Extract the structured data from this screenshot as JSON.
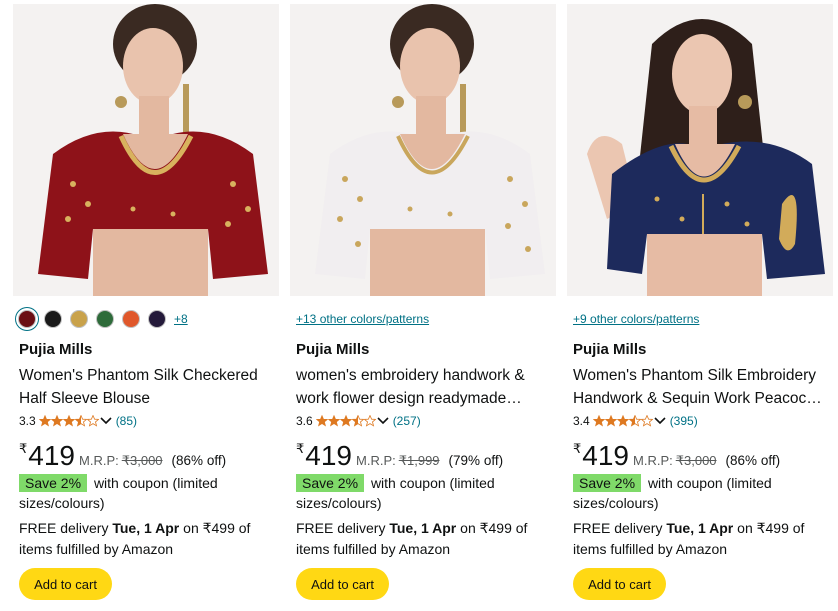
{
  "colors": {
    "link": "#007185",
    "button": "#ffd814",
    "badge": "#7fda69",
    "star": "#de7921"
  },
  "products": [
    {
      "brand": "Pujia Mills",
      "title": "Women's Phantom Silk Checkered Half Sleeve Blouse",
      "rating": "3.3",
      "rating_count": "(85)",
      "currency": "₹",
      "price": "419",
      "mrp_label": "M.R.P:",
      "mrp": "₹3,000",
      "discount": "(86% off)",
      "save_badge": "Save 2%",
      "coupon_text": "with coupon (limited sizes/colours)",
      "delivery_prefix": "FREE delivery",
      "delivery_date": "Tue, 1 Apr",
      "delivery_suffix": "on ₹499 of items fulfilled by Amazon",
      "cart_label": "Add to cart",
      "more_colors": "+8",
      "swatch_colors": [
        "#6b0f14",
        "#1a1a1a",
        "#c9a24b",
        "#2e6b3a",
        "#e0582b",
        "#241a3a"
      ],
      "image_icon": "red-embroidered-blouse-photo"
    },
    {
      "brand": "Pujia Mills",
      "title": "women's embroidery handwork & work flower design readymade…",
      "rating": "3.6",
      "rating_count": "(257)",
      "currency": "₹",
      "price": "419",
      "mrp_label": "M.R.P:",
      "mrp": "₹1,999",
      "discount": "(79% off)",
      "save_badge": "Save 2%",
      "coupon_text": "with coupon (limited sizes/colours)",
      "delivery_prefix": "FREE delivery",
      "delivery_date": "Tue, 1 Apr",
      "delivery_suffix": "on ₹499 of items fulfilled by Amazon",
      "cart_label": "Add to cart",
      "colors_link": "+13 other colors/patterns",
      "image_icon": "white-embroidered-blouse-photo"
    },
    {
      "brand": "Pujia Mills",
      "title": "Women's Phantom Silk Embroidery Handwork & Sequin Work Peacoc…",
      "rating": "3.4",
      "rating_count": "(395)",
      "currency": "₹",
      "price": "419",
      "mrp_label": "M.R.P:",
      "mrp": "₹3,000",
      "discount": "(86% off)",
      "save_badge": "Save 2%",
      "coupon_text": "with coupon (limited sizes/colours)",
      "delivery_prefix": "FREE delivery",
      "delivery_date": "Tue, 1 Apr",
      "delivery_suffix": "on ₹499 of items fulfilled by Amazon",
      "cart_label": "Add to cart",
      "colors_link": "+9 other colors/patterns",
      "image_icon": "navy-peacock-blouse-photo"
    }
  ]
}
